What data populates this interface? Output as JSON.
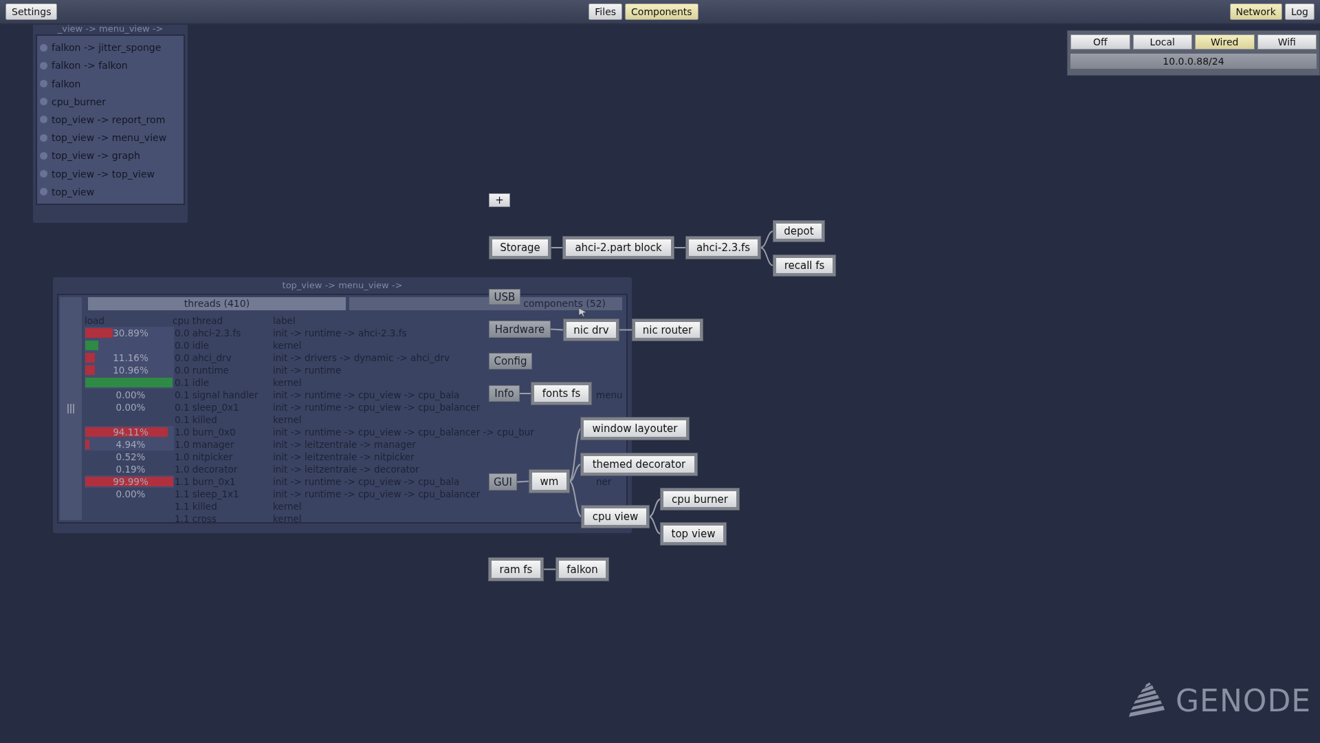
{
  "top_bar": {
    "left": [
      {
        "label": "Settings",
        "selected": false
      }
    ],
    "center": [
      {
        "label": "Files",
        "selected": false
      },
      {
        "label": "Components",
        "selected": true
      }
    ],
    "right": [
      {
        "label": "Network",
        "selected": true
      },
      {
        "label": "Log",
        "selected": false
      }
    ]
  },
  "network_panel": {
    "modes": [
      {
        "label": "Off",
        "selected": false
      },
      {
        "label": "Local",
        "selected": false
      },
      {
        "label": "Wired",
        "selected": true
      },
      {
        "label": "Wifi",
        "selected": false
      }
    ],
    "address": "10.0.0.88/24"
  },
  "menu_window": {
    "title": "_view -> menu_view ->",
    "items": [
      "falkon -> jitter_sponge",
      "falkon -> falkon",
      "falkon",
      "cpu_burner",
      "top_view -> report_rom",
      "top_view -> menu_view",
      "top_view -> graph",
      "top_view -> top_view",
      "top_view"
    ]
  },
  "threads_window": {
    "title": "top_view -> menu_view ->",
    "tabs": [
      {
        "label": "threads (410)",
        "selected": true
      },
      {
        "label": "components (52)",
        "selected": false
      }
    ],
    "columns": [
      "load",
      "cpu thread",
      "label"
    ],
    "rows": [
      {
        "load": "30.89%",
        "level": 0.31,
        "color": "#b0303e",
        "thread": "0.0 ahci-2.3.fs",
        "label": "init -> runtime -> ahci-2.3.fs"
      },
      {
        "level": 0.15,
        "color": "#2e8a45",
        "thread": "0.0 idle",
        "label": "kernel"
      },
      {
        "load": "11.16%",
        "level": 0.11,
        "color": "#b0303e",
        "thread": "0.0 ahci_drv",
        "label": "init -> drivers -> dynamic -> ahci_drv"
      },
      {
        "load": "10.96%",
        "level": 0.11,
        "color": "#b0303e",
        "thread": "0.0 runtime",
        "label": "init -> runtime"
      },
      {
        "level": 0.99,
        "color": "#2e8a45",
        "thread": "0.1 idle",
        "label": "kernel"
      },
      {
        "load": "0.00%",
        "thread": "0.1 signal handler",
        "label": "init -> runtime -> cpu_view -> cpu_bala",
        "tail": "menu"
      },
      {
        "load": "0.00%",
        "thread": "0.1 sleep_0x1",
        "label": "init -> runtime -> cpu_view -> cpu_balancer"
      },
      {
        "thread": "0.1 killed",
        "label": "kernel"
      },
      {
        "load": "94.11%",
        "level": 0.94,
        "color": "#b0303e",
        "thread": "1.0 burn_0x0",
        "label": "init -> runtime -> cpu_view -> cpu_balancer -> cpu_bur"
      },
      {
        "load": "4.94%",
        "level": 0.05,
        "color": "#b0303e",
        "thread": "1.0 manager",
        "label": "init -> leitzentrale -> manager"
      },
      {
        "load": "0.52%",
        "thread": "1.0 nitpicker",
        "label": "init -> leitzentrale -> nitpicker"
      },
      {
        "load": "0.19%",
        "thread": "1.0 decorator",
        "label": "init -> leitzentrale -> decorator"
      },
      {
        "load": "99.99%",
        "level": 1,
        "color": "#b0303e",
        "thread": "1.1 burn_0x1",
        "label": "init -> runtime -> cpu_view -> cpu_bala",
        "tail": "ner"
      },
      {
        "load": "0.00%",
        "thread": "1.1 sleep_1x1",
        "label": "init -> runtime -> cpu_view -> cpu_balancer"
      },
      {
        "thread": "1.1 killed",
        "label": "kernel"
      },
      {
        "thread": "1.1 cross",
        "label": "kernel"
      }
    ]
  },
  "add_button": {
    "label": "+"
  },
  "graph": [
    {
      "label": "Storage",
      "kind": "component",
      "children": [
        {
          "label": "ahci-2.part block",
          "kind": "component",
          "children": [
            {
              "label": "ahci-2.3.fs",
              "kind": "component",
              "children": [
                {
                  "label": "depot",
                  "kind": "component"
                },
                {
                  "label": "recall fs",
                  "kind": "component"
                }
              ]
            }
          ]
        }
      ]
    },
    {
      "label": "USB",
      "kind": "category"
    },
    {
      "label": "Hardware",
      "kind": "category",
      "children": [
        {
          "label": "nic drv",
          "kind": "component",
          "children": [
            {
              "label": "nic router",
              "kind": "component"
            }
          ]
        }
      ]
    },
    {
      "label": "Config",
      "kind": "category"
    },
    {
      "label": "Info",
      "kind": "category",
      "children": [
        {
          "label": "fonts fs",
          "kind": "component"
        }
      ]
    },
    {
      "label": "GUI",
      "kind": "category",
      "children": [
        {
          "label": "wm",
          "kind": "component",
          "children": [
            {
              "label": "window layouter",
              "kind": "component"
            },
            {
              "label": "themed decorator",
              "kind": "component"
            },
            {
              "label": "cpu view",
              "kind": "component",
              "children": [
                {
                  "label": "cpu burner",
                  "kind": "component"
                },
                {
                  "label": "top view",
                  "kind": "component"
                }
              ]
            }
          ]
        }
      ]
    },
    {
      "label": "ram fs",
      "kind": "component",
      "children": [
        {
          "label": "falkon",
          "kind": "component"
        }
      ]
    }
  ],
  "logo": {
    "text": "GENODE"
  }
}
